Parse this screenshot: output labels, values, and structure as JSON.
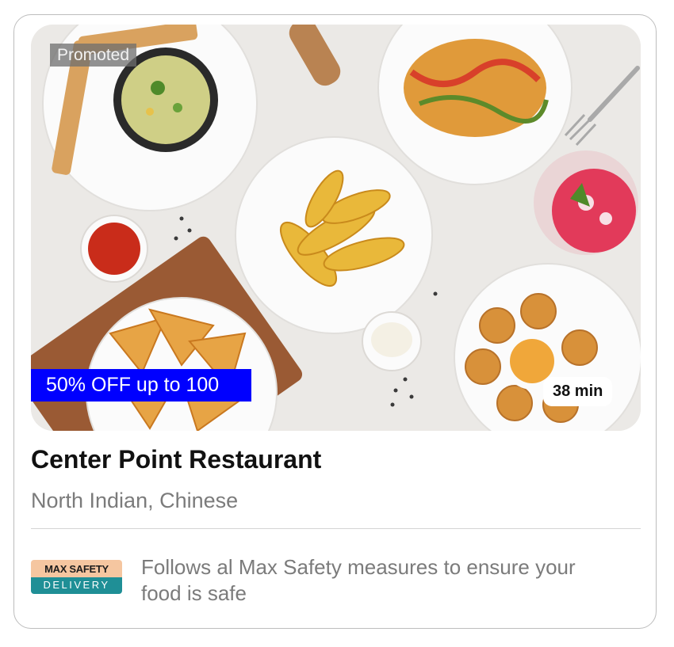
{
  "restaurant": {
    "promoted_label": "Promoted",
    "offer": "50% OFF up to 100",
    "delivery_time": "38 min",
    "name": "Center Point Restaurant",
    "cuisine": "North Indian, Chinese"
  },
  "safety": {
    "badge_top": "MAX SAFETY",
    "badge_bottom": "DELIVERY",
    "message": "Follows al Max Safety measures to ensure your food is safe"
  },
  "colors": {
    "offer_bg": "#0000ff",
    "badge_top": "#f5c6a0",
    "badge_bottom": "#1f8f96"
  }
}
